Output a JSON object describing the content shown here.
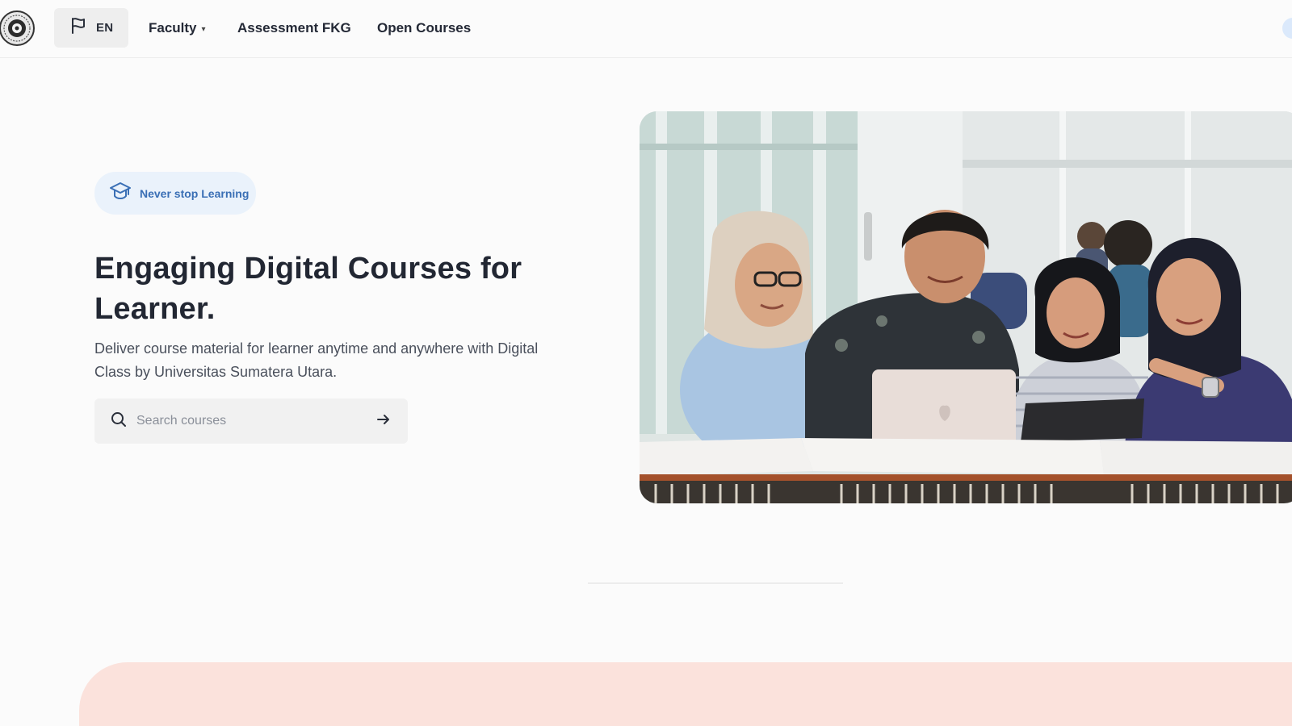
{
  "nav": {
    "language": "EN",
    "links": [
      {
        "label": "Faculty",
        "has_dropdown": true
      },
      {
        "label": "Assessment FKG"
      },
      {
        "label": "Open Courses"
      }
    ]
  },
  "hero": {
    "badge": "Never stop Learning",
    "title": "Engaging Digital Courses for Learner.",
    "description": "Deliver course material for learner anytime and anywhere with Digital Class by Universitas Sumatera Utara.",
    "search": {
      "placeholder": "Search courses",
      "value": ""
    }
  },
  "icons": {
    "logo": "university-seal-icon",
    "language": "flag-icon",
    "badge": "graduation-cap-icon",
    "search": "search-icon",
    "submit": "arrow-right-icon"
  },
  "colors": {
    "accent": "#3a6fb5",
    "badge_bg": "#eaf2fb",
    "promo_band": "#fbe2dc"
  }
}
